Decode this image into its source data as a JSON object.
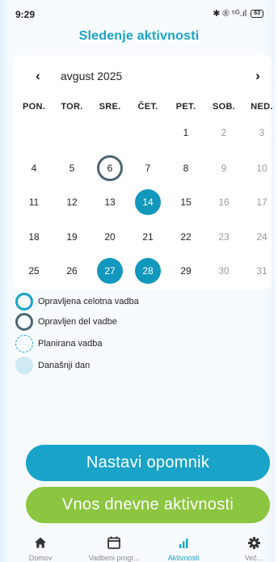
{
  "status_bar": {
    "time": "9:29",
    "icons_text": "✱ ® ⁵ᴳ.ıl",
    "battery": "63"
  },
  "title": "Sledenje aktivnosti",
  "calendar": {
    "prev_icon": "chevron-left-icon",
    "next_icon": "chevron-right-icon",
    "prev_glyph": "‹",
    "next_glyph": "›",
    "month_label": "avgust 2025",
    "weekdays": [
      "PON.",
      "TOR.",
      "SRE.",
      "ČET.",
      "PET.",
      "SOB.",
      "NED."
    ],
    "weeks": [
      [
        "",
        "",
        "",
        "",
        "1",
        "2",
        "3"
      ],
      [
        "4",
        "5",
        "6",
        "7",
        "8",
        "9",
        "10"
      ],
      [
        "11",
        "12",
        "13",
        "14",
        "15",
        "16",
        "17"
      ],
      [
        "18",
        "19",
        "20",
        "21",
        "22",
        "23",
        "24"
      ],
      [
        "25",
        "26",
        "27",
        "28",
        "29",
        "30",
        "31"
      ]
    ],
    "today": "6",
    "completed_days": [
      "14",
      "27",
      "28"
    ]
  },
  "legend": [
    {
      "label": "Opravljena celotna vadba",
      "style": "full"
    },
    {
      "label": "Opravljen del vadbe",
      "style": "partial"
    },
    {
      "label": "Planirana vadba",
      "style": "planned"
    },
    {
      "label": "Današnji dan",
      "style": "today"
    }
  ],
  "buttons": {
    "reminder": "Nastavi opomnik",
    "activity": "Vnos dnevne aktivnosti"
  },
  "tabs": [
    {
      "label": "Domov",
      "icon": "home-icon",
      "active": false
    },
    {
      "label": "Vadbeni progr...",
      "icon": "calendar-icon",
      "active": false
    },
    {
      "label": "Aktivnosti",
      "icon": "bar-chart-icon",
      "active": true
    },
    {
      "label": "Več...",
      "icon": "gear-icon",
      "active": false
    }
  ],
  "colors": {
    "accent": "#1aa3c8",
    "completed": "#1297bd",
    "partial_ring": "#4b6675",
    "today_fill": "#cfeaf4",
    "green_button": "#8cc540",
    "weekend_text": "#9a9a9a",
    "tab_inactive": "#8a8a8a"
  }
}
